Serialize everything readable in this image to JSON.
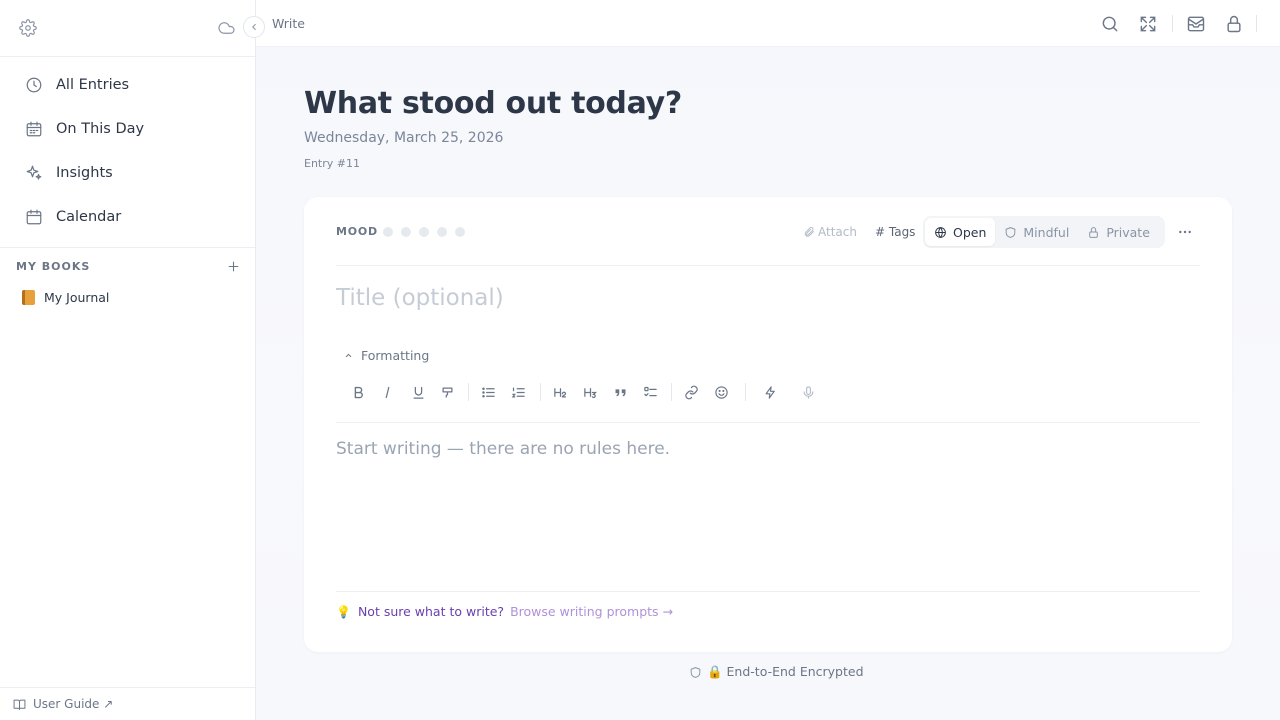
{
  "sidebar": {
    "nav": [
      {
        "label": "All Entries",
        "icon": "clock-icon"
      },
      {
        "label": "On This Day",
        "icon": "calendar-grid-icon"
      },
      {
        "label": "Insights",
        "icon": "sparkle-icon"
      },
      {
        "label": "Calendar",
        "icon": "calendar-icon"
      }
    ],
    "books_title": "MY BOOKS",
    "books": [
      {
        "label": "My Journal",
        "icon": "book-icon",
        "color": "#e8a13a"
      }
    ],
    "footer_label": "User Guide ↗"
  },
  "topbar": {
    "breadcrumb": "Write"
  },
  "page": {
    "heading": "What stood out today?",
    "date": "Wednesday, March 25, 2026",
    "entry_number": "Entry #11"
  },
  "editor": {
    "mood_label": "MOOD",
    "attach_label": "Attach",
    "tags_label": "# Tags",
    "modes": [
      {
        "label": "Open",
        "icon": "globe-icon",
        "active": true
      },
      {
        "label": "Mindful",
        "icon": "shield-icon",
        "active": false
      },
      {
        "label": "Private",
        "icon": "lock-icon",
        "active": false
      }
    ],
    "title_placeholder": "Title (optional)",
    "formatting_label": "Formatting",
    "body_placeholder": "Start writing — there are no rules here.",
    "prompt_question": "Not sure what to write?",
    "prompt_link": "Browse writing prompts →"
  },
  "footer": {
    "encryption_label": "🔒 End-to-End Encrypted"
  },
  "colors": {
    "accent_purple": "#6a3fb0",
    "prompt_link": "#b091d9",
    "text": "#2d3748",
    "muted": "#6b7687"
  }
}
